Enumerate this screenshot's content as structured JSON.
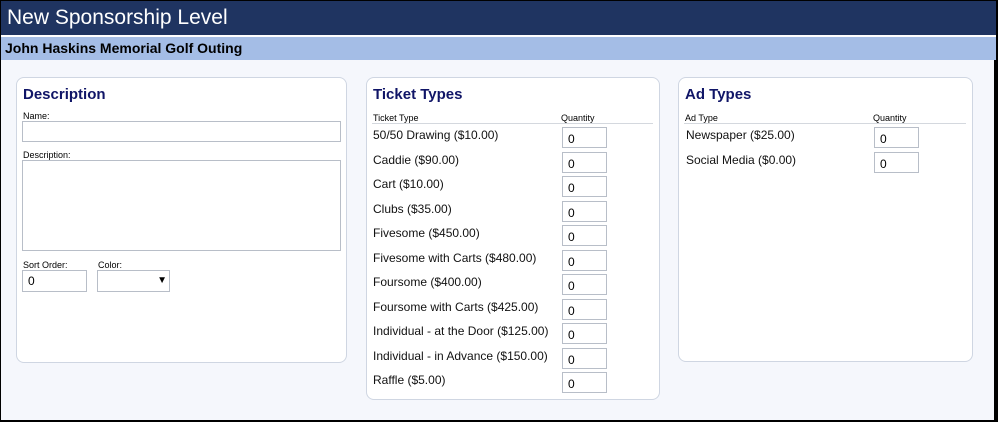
{
  "window": {
    "title": "New Sponsorship Level"
  },
  "event": {
    "name": "John Haskins Memorial Golf Outing"
  },
  "description_panel": {
    "heading": "Description",
    "name_label": "Name:",
    "name_value": "",
    "description_label": "Description:",
    "description_value": "",
    "sort_order_label": "Sort Order:",
    "sort_order_value": "0",
    "color_label": "Color:",
    "color_value": ""
  },
  "ticket_types_panel": {
    "heading": "Ticket Types",
    "col_type": "Ticket Type",
    "col_qty": "Quantity",
    "rows": [
      {
        "label": "50/50 Drawing ($10.00)",
        "qty": "0"
      },
      {
        "label": "Caddie ($90.00)",
        "qty": "0"
      },
      {
        "label": "Cart ($10.00)",
        "qty": "0"
      },
      {
        "label": "Clubs ($35.00)",
        "qty": "0"
      },
      {
        "label": "Fivesome ($450.00)",
        "qty": "0"
      },
      {
        "label": "Fivesome with Carts ($480.00)",
        "qty": "0"
      },
      {
        "label": "Foursome ($400.00)",
        "qty": "0"
      },
      {
        "label": "Foursome with Carts ($425.00)",
        "qty": "0"
      },
      {
        "label": "Individual - at the Door ($125.00)",
        "qty": "0"
      },
      {
        "label": "Individual - in Advance ($150.00)",
        "qty": "0"
      },
      {
        "label": "Raffle ($5.00)",
        "qty": "0"
      }
    ]
  },
  "ad_types_panel": {
    "heading": "Ad Types",
    "col_type": "Ad Type",
    "col_qty": "Quantity",
    "rows": [
      {
        "label": "Newspaper ($25.00)",
        "qty": "0"
      },
      {
        "label": "Social Media ($0.00)",
        "qty": "0"
      }
    ]
  },
  "colors": {
    "title_bar": "#1f3461",
    "sub_bar": "#a4bde6",
    "heading_text": "#101567"
  },
  "icons": {
    "color_dropdown": "dropdown-arrow-icon"
  }
}
